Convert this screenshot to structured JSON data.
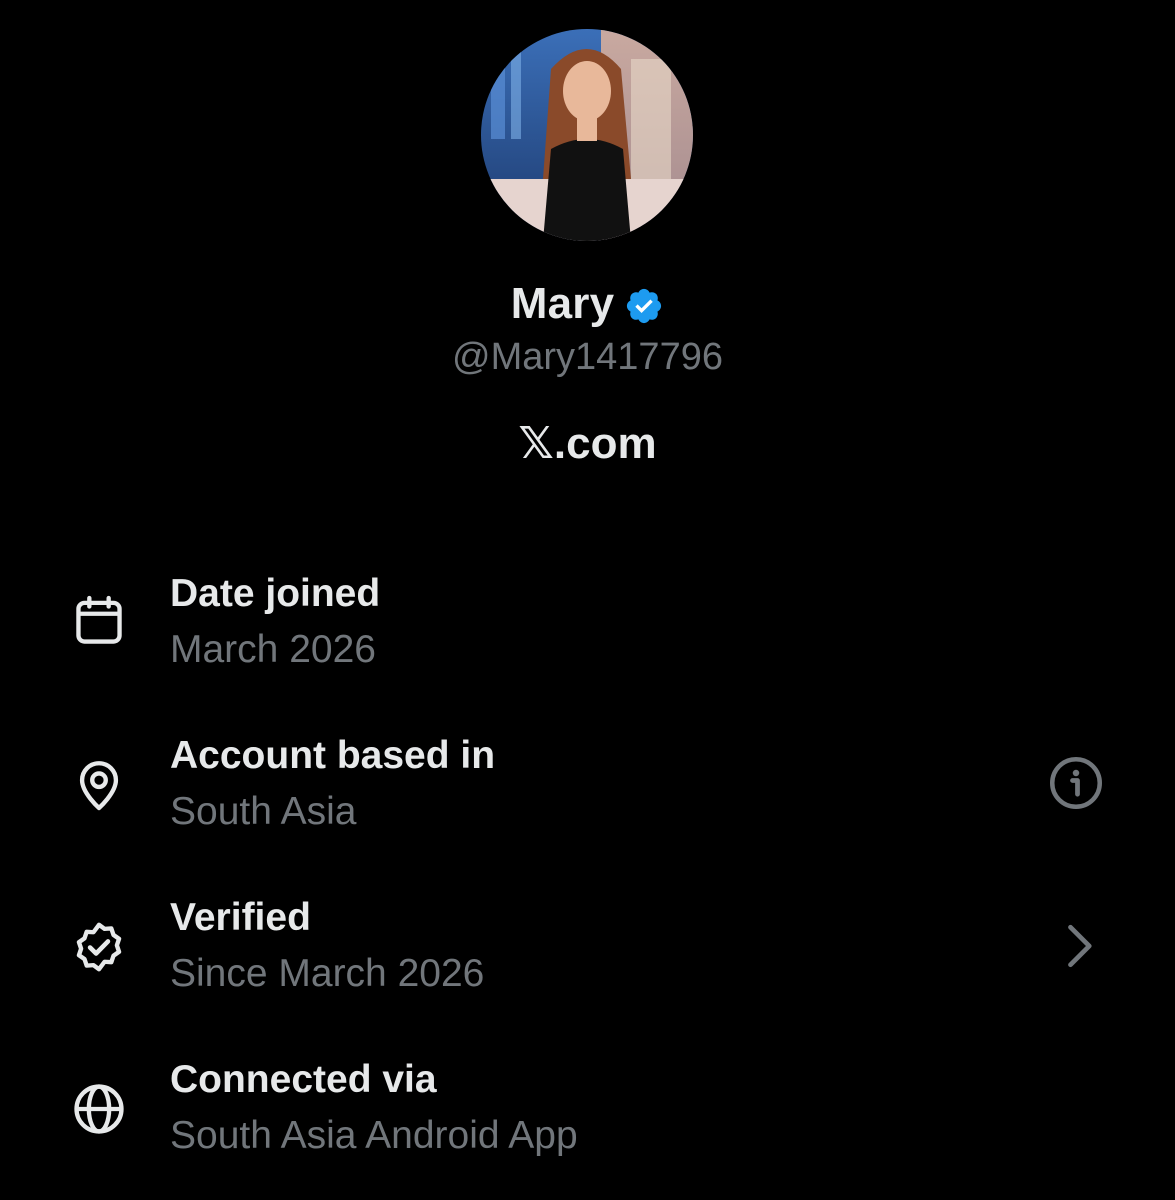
{
  "profile": {
    "display_name": "Mary",
    "handle": "@Mary1417796",
    "site": "𝕏.com",
    "avatar_alt": "profile photo",
    "verified_color": "#1d9bf0"
  },
  "rows": [
    {
      "title": "Date joined",
      "value": "March 2026",
      "icon": "calendar-icon"
    },
    {
      "title": "Account based in",
      "value": "South Asia",
      "icon": "location-pin-icon",
      "action_icon": "info-icon"
    },
    {
      "title": "Verified",
      "value": "Since March 2026",
      "icon": "verified-badge-icon",
      "action_icon": "chevron-right-icon"
    },
    {
      "title": "Connected via",
      "value": "South Asia Android App",
      "icon": "globe-icon"
    }
  ],
  "colors": {
    "background": "#000000",
    "primary_text": "#e7e9ea",
    "secondary_text": "#71767b",
    "accent": "#1d9bf0"
  }
}
